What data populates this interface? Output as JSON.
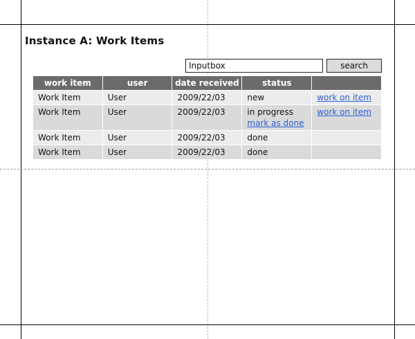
{
  "page": {
    "title": "Instance A: Work Items"
  },
  "search": {
    "value": "Inputbox",
    "button_label": "search"
  },
  "table": {
    "headers": [
      "work item",
      "user",
      "date received",
      "status",
      ""
    ],
    "rows": [
      {
        "work_item": "Work Item",
        "user": "User",
        "date": "2009/22/03",
        "status": "new",
        "status_link": "",
        "action": "work on item"
      },
      {
        "work_item": "Work Item",
        "user": "User",
        "date": "2009/22/03",
        "status": "in progress",
        "status_link": "mark as done",
        "action": "work on item"
      },
      {
        "work_item": "Work Item",
        "user": "User",
        "date": "2009/22/03",
        "status": "done",
        "status_link": "",
        "action": ""
      },
      {
        "work_item": "Work Item",
        "user": "User",
        "date": "2009/22/03",
        "status": "done",
        "status_link": "",
        "action": ""
      }
    ]
  },
  "colors": {
    "header_bg": "#6b6b6b",
    "row_light": "#ececec",
    "row_dark": "#dadada",
    "link": "#2a5fd6",
    "button_bg": "#dcdcdc"
  }
}
